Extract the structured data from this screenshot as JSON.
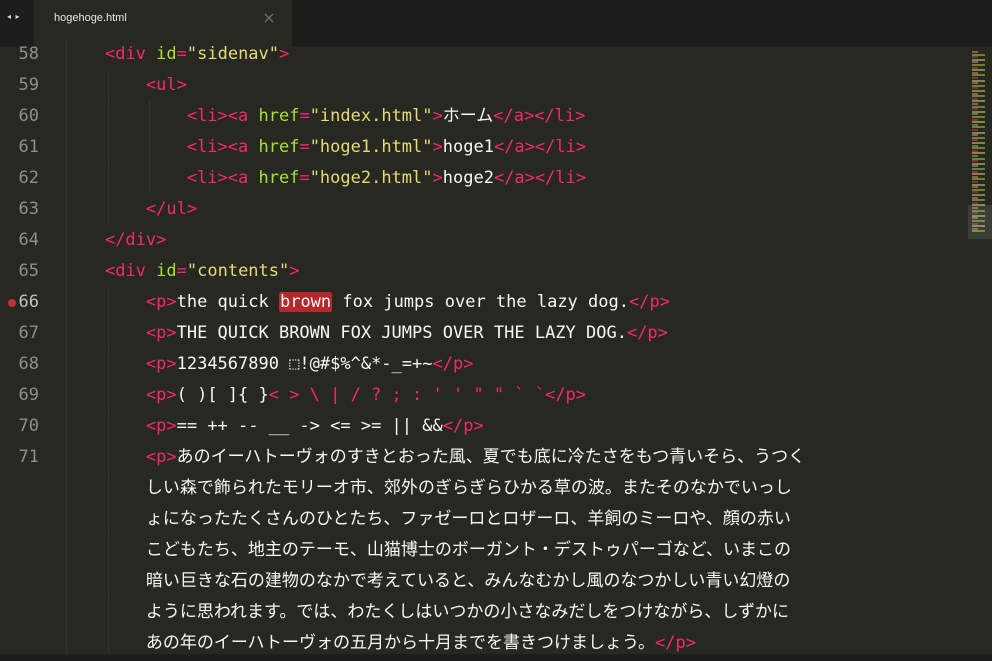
{
  "nav": {
    "arrows": "◂ ▸"
  },
  "tab": {
    "title": "hogehoge.html",
    "close": "×"
  },
  "lines": [
    {
      "no": "58",
      "tok": [
        [
          "    ",
          ""
        ],
        [
          "<",
          "t"
        ],
        [
          "div",
          "t"
        ],
        [
          " id",
          "a"
        ],
        [
          "=",
          "t"
        ],
        [
          "\"sidenav\"",
          "s"
        ],
        [
          ">",
          "t"
        ]
      ]
    },
    {
      "no": "59",
      "tok": [
        [
          "        ",
          ""
        ],
        [
          "<ul>",
          "t"
        ]
      ]
    },
    {
      "no": "60",
      "tok": [
        [
          "            ",
          ""
        ],
        [
          "<li><a",
          "t"
        ],
        [
          " href",
          "a"
        ],
        [
          "=",
          "t"
        ],
        [
          "\"index.html\"",
          "s"
        ],
        [
          ">",
          "t"
        ],
        [
          "ホーム",
          ""
        ],
        [
          "</a></li>",
          "t"
        ]
      ]
    },
    {
      "no": "61",
      "tok": [
        [
          "            ",
          ""
        ],
        [
          "<li><a",
          "t"
        ],
        [
          " href",
          "a"
        ],
        [
          "=",
          "t"
        ],
        [
          "\"hoge1.html\"",
          "s"
        ],
        [
          ">",
          "t"
        ],
        [
          "hoge1",
          ""
        ],
        [
          "</a></li>",
          "t"
        ]
      ]
    },
    {
      "no": "62",
      "tok": [
        [
          "            ",
          ""
        ],
        [
          "<li><a",
          "t"
        ],
        [
          " href",
          "a"
        ],
        [
          "=",
          "t"
        ],
        [
          "\"hoge2.html\"",
          "s"
        ],
        [
          ">",
          "t"
        ],
        [
          "hoge2",
          ""
        ],
        [
          "</a></li>",
          "t"
        ]
      ]
    },
    {
      "no": "63",
      "tok": [
        [
          "        ",
          ""
        ],
        [
          "</ul>",
          "t"
        ]
      ]
    },
    {
      "no": "64",
      "tok": [
        [
          "    ",
          ""
        ],
        [
          "</div>",
          "t"
        ]
      ]
    },
    {
      "no": "65",
      "tok": [
        [
          "    ",
          ""
        ],
        [
          "<",
          "t"
        ],
        [
          "div",
          "t"
        ],
        [
          " id",
          "a"
        ],
        [
          "=",
          "t"
        ],
        [
          "\"contents\"",
          "s"
        ],
        [
          ">",
          "t"
        ]
      ]
    },
    {
      "no": "66",
      "breakpoint": true,
      "tok": [
        [
          "        ",
          ""
        ],
        [
          "<p>",
          "t"
        ],
        [
          "the quick ",
          ""
        ],
        [
          "brown",
          "hl"
        ],
        [
          " fox jumps over the lazy dog.",
          ""
        ],
        [
          "</p>",
          "t"
        ]
      ]
    },
    {
      "no": "67",
      "tok": [
        [
          "        ",
          ""
        ],
        [
          "<p>",
          "t"
        ],
        [
          "THE QUICK BROWN FOX JUMPS OVER THE LAZY DOG.",
          ""
        ],
        [
          "</p>",
          "t"
        ]
      ]
    },
    {
      "no": "68",
      "tok": [
        [
          "        ",
          ""
        ],
        [
          "<p>",
          "t"
        ],
        [
          "1234567890 ⬚!@#$%^&*-_=+~",
          ""
        ],
        [
          "</p>",
          "t"
        ]
      ]
    },
    {
      "no": "69",
      "tok": [
        [
          "        ",
          ""
        ],
        [
          "<p>",
          "t"
        ],
        [
          "( )[ ]{ }",
          ""
        ],
        [
          "< > \\ | / ? ; : ' ' \" \" ` `",
          "t"
        ],
        [
          "</p>",
          "t"
        ]
      ]
    },
    {
      "no": "70",
      "tok": [
        [
          "        ",
          ""
        ],
        [
          "<p>",
          "t"
        ],
        [
          "== ++ -- __ -> <= >= || &&",
          ""
        ],
        [
          "</p>",
          "t"
        ]
      ]
    },
    {
      "no": "71",
      "tok": [
        [
          "        ",
          ""
        ],
        [
          "<p>",
          "t"
        ],
        [
          "あのイーハトーヴォのすきとおった風、夏でも底に冷たさをもつ青いそら、うつく",
          ""
        ]
      ]
    },
    {
      "no": "",
      "tok": [
        [
          "        ",
          ""
        ],
        [
          "しい森で飾られたモリーオ市、郊外のぎらぎらひかる草の波。またそのなかでいっし",
          ""
        ]
      ]
    },
    {
      "no": "",
      "tok": [
        [
          "        ",
          ""
        ],
        [
          "ょになったたくさんのひとたち、ファゼーロとロザーロ、羊飼のミーロや、顔の赤い",
          ""
        ]
      ]
    },
    {
      "no": "",
      "tok": [
        [
          "        ",
          ""
        ],
        [
          "こどもたち、地主のテーモ、山猫博士のボーガント・デストゥパーゴなど、いまこの",
          ""
        ]
      ]
    },
    {
      "no": "",
      "tok": [
        [
          "        ",
          ""
        ],
        [
          "暗い巨きな石の建物のなかで考えていると、みんなむかし風のなつかしい青い幻燈の",
          ""
        ]
      ]
    },
    {
      "no": "",
      "tok": [
        [
          "        ",
          ""
        ],
        [
          "ように思われます。では、わたくしはいつかの小さなみだしをつけながら、しずかに",
          ""
        ]
      ]
    },
    {
      "no": "",
      "tok": [
        [
          "        ",
          ""
        ],
        [
          "あの年のイーハトーヴォの五月から十月までを書きつけましょう。",
          ""
        ],
        [
          "</p>",
          "t"
        ]
      ]
    }
  ],
  "colors": {
    "background": "#272822",
    "tag": "#f92672",
    "attribute": "#a6e22e",
    "string": "#e6db74",
    "text": "#f8f8f2",
    "highlight": "#b3292e",
    "breakpoint": "#c4313b"
  }
}
